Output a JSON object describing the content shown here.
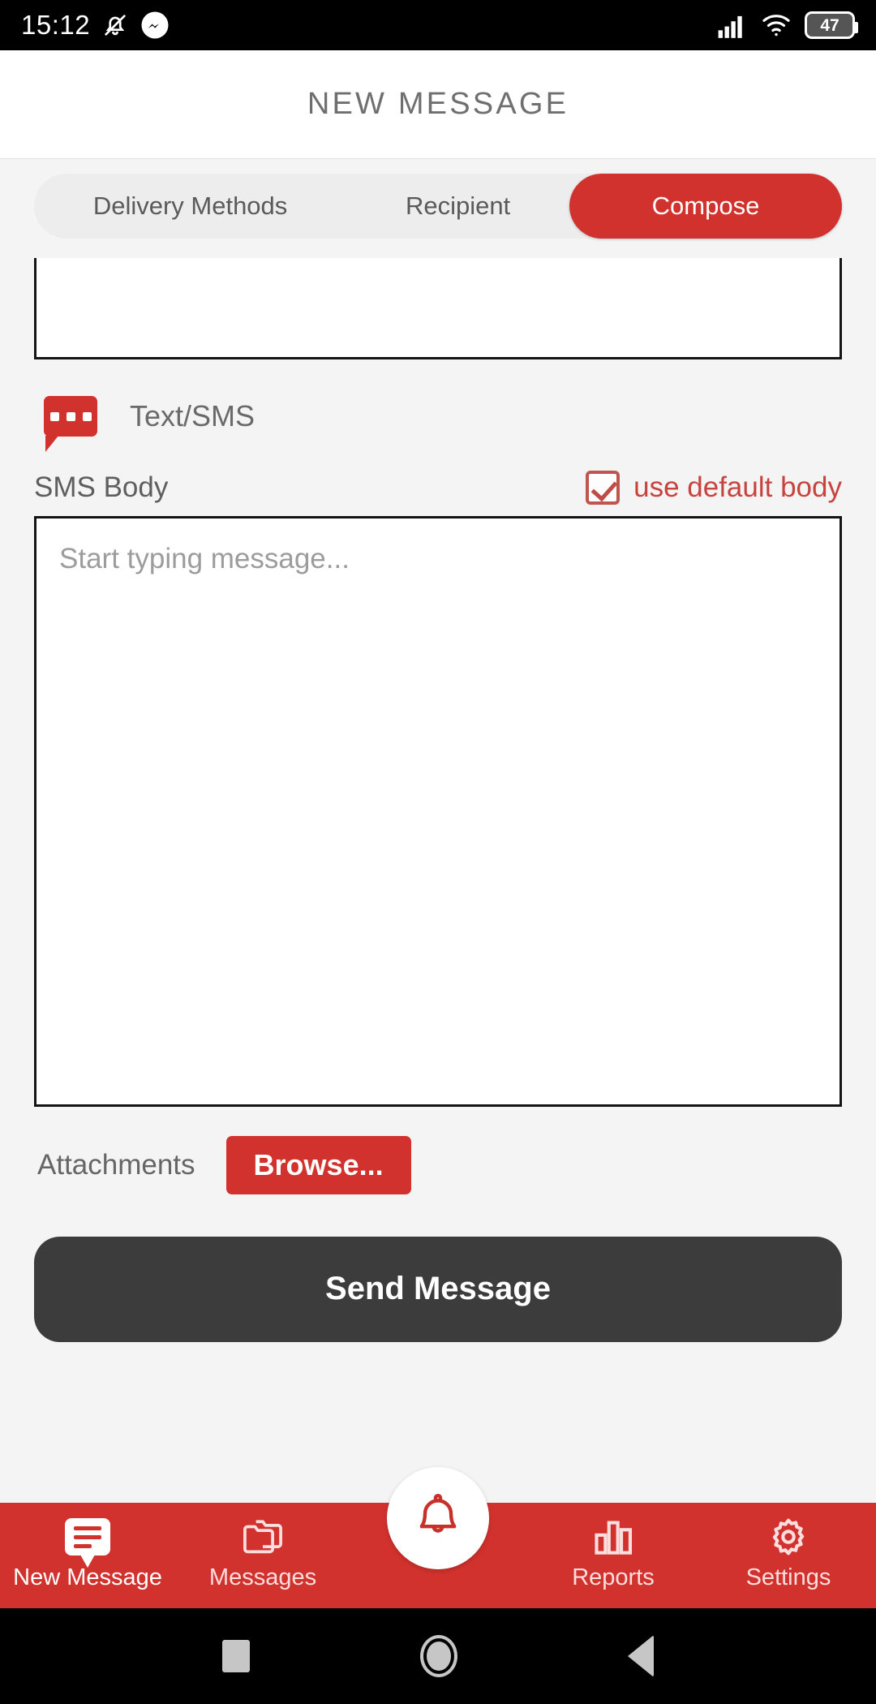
{
  "status_bar": {
    "time": "15:12",
    "icons_left": [
      "bell-muted-icon",
      "messenger-icon"
    ],
    "icons_right": [
      "signal-bars-icon",
      "wifi-icon"
    ],
    "battery_level": "47"
  },
  "header": {
    "title": "NEW MESSAGE"
  },
  "tabs": [
    {
      "label": "Delivery Methods",
      "active": false
    },
    {
      "label": "Recipient",
      "active": false
    },
    {
      "label": "Compose",
      "active": true
    }
  ],
  "compose": {
    "channel": {
      "icon": "sms-bubble-icon",
      "label": "Text/SMS"
    },
    "sms_body": {
      "label": "SMS Body",
      "use_default_label": "use default body",
      "use_default_checked": true,
      "placeholder": "Start typing message...",
      "value": ""
    },
    "attachments": {
      "label": "Attachments",
      "browse_label": "Browse..."
    },
    "send_label": "Send Message"
  },
  "bottom_nav": [
    {
      "label": "New Message",
      "icon": "chat-icon",
      "active": true
    },
    {
      "label": "Messages",
      "icon": "folders-icon",
      "active": false
    },
    {
      "label": "",
      "icon": "bell-icon",
      "active": false
    },
    {
      "label": "Reports",
      "icon": "bar-chart-icon",
      "active": false
    },
    {
      "label": "Settings",
      "icon": "gear-icon",
      "active": false
    }
  ],
  "system_nav": {
    "recents": "square-icon",
    "home": "circle-icon",
    "back": "triangle-back-icon"
  },
  "colors": {
    "brand_red": "#d2322d",
    "send_button": "#3c3c3c",
    "page_background": "#f4f4f4",
    "checkbox_red": "#c7433e"
  }
}
